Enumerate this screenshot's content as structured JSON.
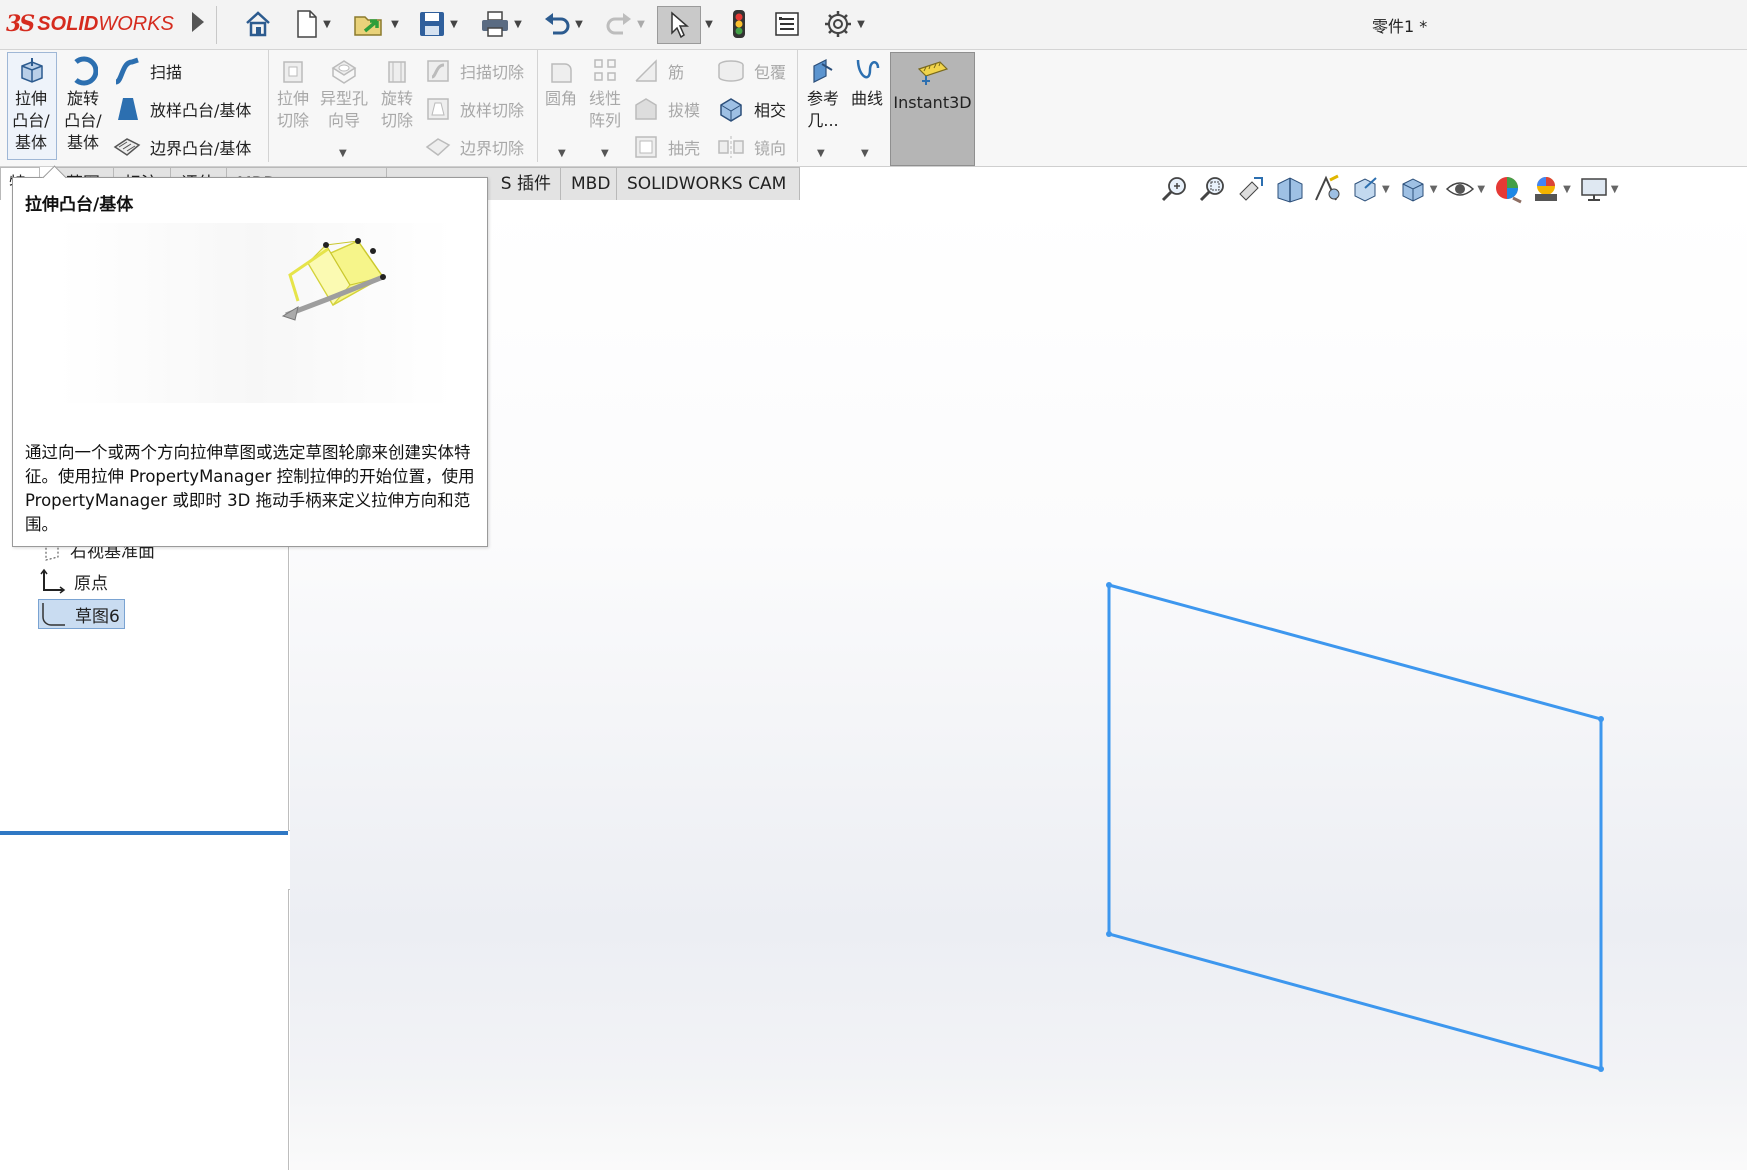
{
  "app": {
    "brand_prefix": "3S",
    "brand_bold": "SOLID",
    "brand_light": "WORKS",
    "document_title": "零件1 *"
  },
  "ribbon": {
    "extrude_boss": "拉伸\n凸台/\n基体",
    "revolve_boss": "旋转\n凸台/\n基体",
    "sweep": "扫描",
    "loft_boss": "放样凸台/基体",
    "boundary_boss": "边界凸台/基体",
    "extrude_cut": "拉伸\n切除",
    "hole_wizard": "异型孔\n向导",
    "revolve_cut": "旋转\n切除",
    "sweep_cut": "扫描切除",
    "loft_cut": "放样切除",
    "boundary_cut": "边界切除",
    "fillet": "圆角",
    "linear_pattern": "线性\n阵列",
    "rib": "筋",
    "draft": "拔模",
    "shell": "抽壳",
    "wrap": "包覆",
    "intersect": "相交",
    "mirror": "镜向",
    "reference_geometry": "参考\n几...",
    "curves": "曲线",
    "instant3d": "Instant3D"
  },
  "tabs": [
    "特征",
    "草图",
    "标注",
    "评估",
    "MBD Dimensions",
    "SOLIDWORKS 插件",
    "MBD",
    "SOLIDWORKS CAM"
  ],
  "tabs_visible": [
    "特",
    "草图",
    "标注",
    "评估",
    "MBD Dimensions",
    "S 插件",
    "MBD",
    "SOLIDWORKS CAM"
  ],
  "tree": {
    "right_plane": "右视基准面",
    "origin": "原点",
    "sketch6": "草图6"
  },
  "tooltip": {
    "title": "拉伸凸台/基体",
    "description": "通过向一个或两个方向拉伸草图或选定草图轮廓来创建实体特征。使用拉伸 PropertyManager 控制拉伸的开始位置，使用 PropertyManager 或即时 3D 拖动手柄来定义拉伸方向和范围。"
  },
  "sketch": {
    "color": "#3d97ee",
    "shape": "parallelogram"
  },
  "colors": {
    "brand": "#d52b1e",
    "selection": "#c9dcf1",
    "rollback_bar": "#2f78c4"
  }
}
